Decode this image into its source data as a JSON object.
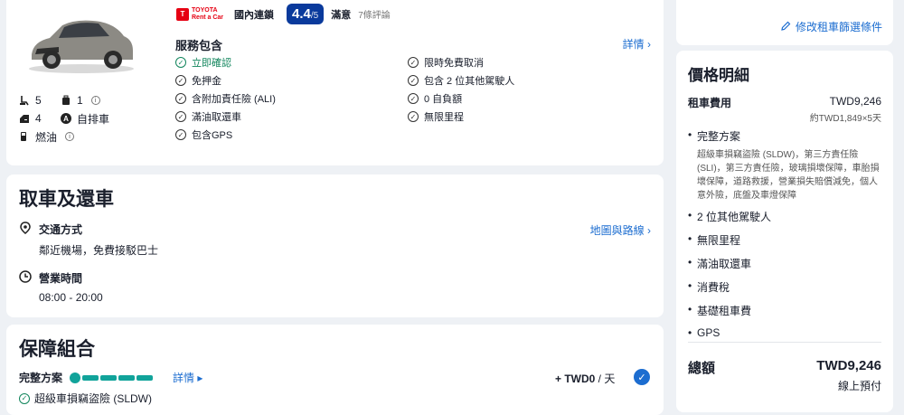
{
  "vehicle": {
    "specs": [
      {
        "icon": "seat-icon",
        "value": "5"
      },
      {
        "icon": "luggage-icon",
        "value": "1"
      },
      {
        "icon": "door-icon",
        "value": "4"
      },
      {
        "icon": "automatic-transmission-icon",
        "value": "自排車"
      },
      {
        "icon": "fuel-icon",
        "value": "燃油"
      }
    ]
  },
  "vendor": {
    "logo_line1": "TOYOTA",
    "logo_line2": "Rent a Car",
    "chain": "國內連鎖",
    "score": "4.4",
    "score_max": "/5",
    "rating_label": "滿意",
    "reviews": "7條評論"
  },
  "services": {
    "title": "服務包含",
    "details": "詳情",
    "items": [
      {
        "label": "立即確認",
        "green": true
      },
      {
        "label": "限時免費取消",
        "green": false
      },
      {
        "label": "免押金",
        "green": false
      },
      {
        "label": "包含 2 位其他駕駛人",
        "green": false
      },
      {
        "label": "含附加責任險 (ALI)",
        "green": false
      },
      {
        "label": "0 自負額",
        "green": false
      },
      {
        "label": "滿油取還車",
        "green": false
      },
      {
        "label": "無限里程",
        "green": false
      },
      {
        "label": "包含GPS",
        "green": false
      }
    ]
  },
  "pickup": {
    "title": "取車及還車",
    "transport_label": "交通方式",
    "transport_value": "鄰近機場，免費接駁巴士",
    "map_link": "地圖與路線",
    "hours_label": "營業時間",
    "hours_value": "08:00 - 20:00"
  },
  "protection": {
    "title": "保障組合",
    "plan_name": "完整方案",
    "plan_link": "詳情",
    "price": "+ TWD0",
    "price_unit": " / 天",
    "included": "超級車損竊盜險 (SLDW)"
  },
  "sidebar": {
    "modify_link": "修改租車篩選條件",
    "price_title": "價格明細",
    "rent_label": "租車費用",
    "rent_value": "TWD9,246",
    "rent_sub": "約TWD1,849×5天",
    "plan_label": "完整方案",
    "plan_desc": "超級車損竊盜險 (SLDW)，第三方責任險 (SLI)，第三方責任險，玻璃損壞保障，車胎損壞保障，道路救援，營業損失賠償減免，個人意外險，底盤及車燈保障",
    "items": [
      "2 位其他駕駛人",
      "無限里程",
      "滿油取還車",
      "消費稅",
      "基礎租車費",
      "GPS"
    ],
    "total_label": "總額",
    "total_value": "TWD9,246",
    "pay_note": "線上預付"
  },
  "colors": {
    "accent": "#1c6dd0",
    "score_bg": "#0a3a9c",
    "green": "#11855c",
    "teal": "#11a39a",
    "brand_red": "#e60012"
  }
}
